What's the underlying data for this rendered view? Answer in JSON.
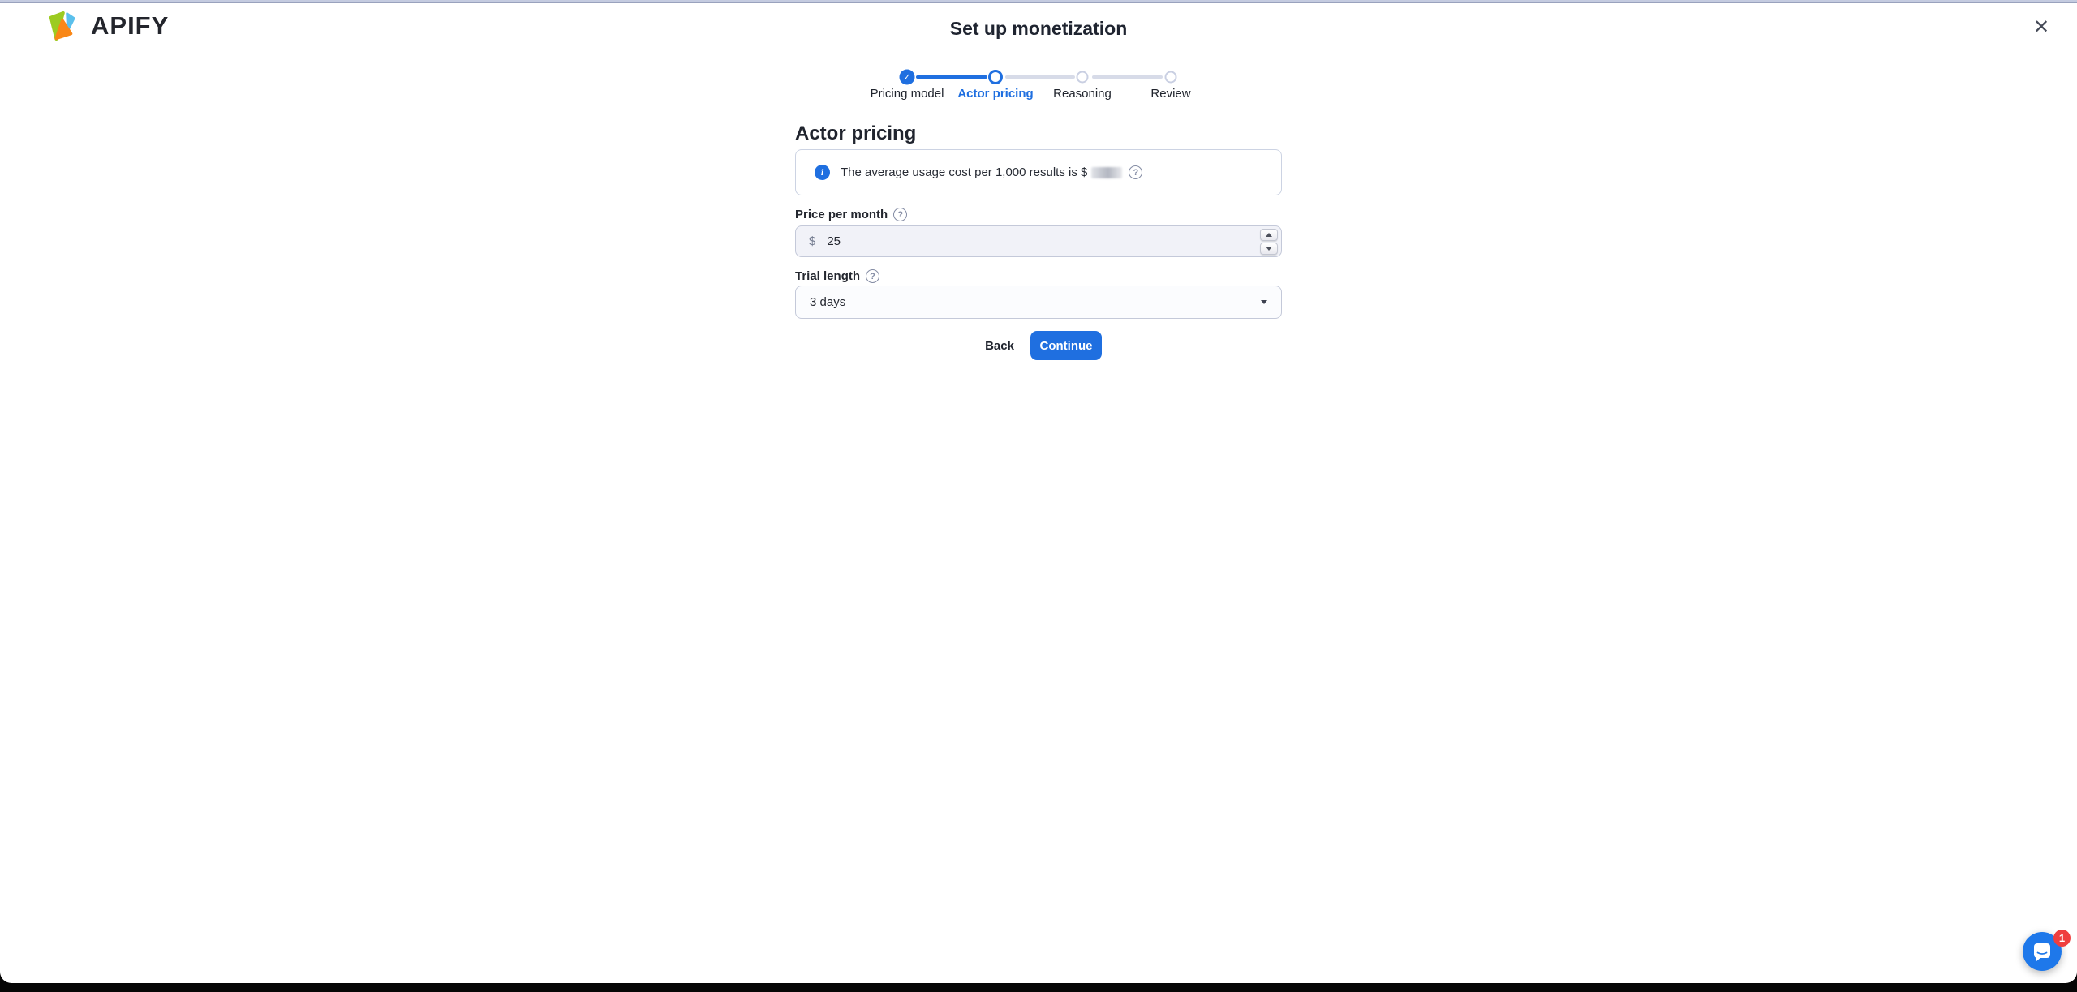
{
  "brand": {
    "name": "APIFY"
  },
  "modal": {
    "title": "Set up monetization",
    "close_glyph": "✕"
  },
  "stepper": {
    "steps": [
      {
        "label": "Pricing model",
        "state": "completed"
      },
      {
        "label": "Actor pricing",
        "state": "active"
      },
      {
        "label": "Reasoning",
        "state": "upcoming"
      },
      {
        "label": "Review",
        "state": "upcoming"
      }
    ],
    "check_glyph": "✓"
  },
  "form": {
    "heading": "Actor pricing",
    "banner": {
      "text_before_value": "The average usage cost per 1,000 results is $",
      "value_obscured": true,
      "help_glyph": "?"
    },
    "price": {
      "label": "Price per month",
      "help_glyph": "?",
      "currency_prefix": "$",
      "value": "25"
    },
    "trial": {
      "label": "Trial length",
      "help_glyph": "?",
      "selected_option": "3 days"
    },
    "actions": {
      "back": "Back",
      "continue": "Continue"
    },
    "info_glyph": "i"
  },
  "chat": {
    "unread_count": "1"
  },
  "colors": {
    "accent_blue": "#1f6fe0",
    "badge_red": "#ef3e3e",
    "inactive_gray": "#d7dbe8",
    "field_bg": "#f1f2f8"
  }
}
